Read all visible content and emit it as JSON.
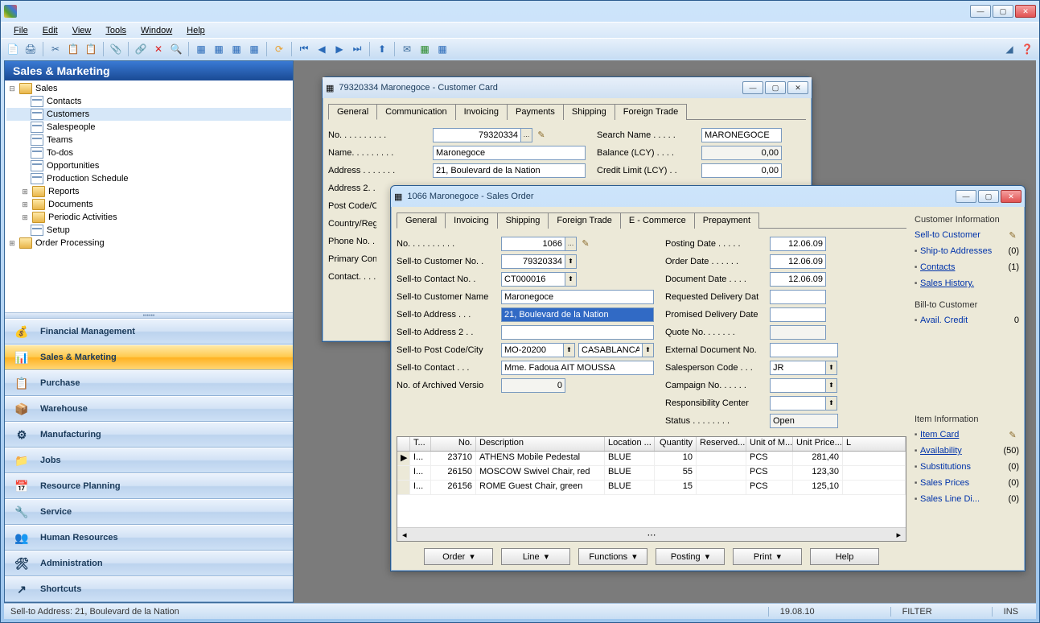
{
  "menubar": [
    "File",
    "Edit",
    "View",
    "Tools",
    "Window",
    "Help"
  ],
  "navigator": {
    "title": "Sales & Marketing",
    "tree": {
      "root": "Sales",
      "items": [
        "Contacts",
        "Customers",
        "Salespeople",
        "Teams",
        "To-dos",
        "Opportunities",
        "Production Schedule",
        "Reports",
        "Documents",
        "Periodic Activities",
        "Setup"
      ],
      "second_root": "Order Processing"
    },
    "buttons": [
      "Financial Management",
      "Sales & Marketing",
      "Purchase",
      "Warehouse",
      "Manufacturing",
      "Jobs",
      "Resource Planning",
      "Service",
      "Human Resources",
      "Administration",
      "Shortcuts"
    ],
    "active_button": 1
  },
  "customer_card": {
    "title": "79320334 Maronegoce - Customer Card",
    "tabs": [
      "General",
      "Communication",
      "Invoicing",
      "Payments",
      "Shipping",
      "Foreign Trade"
    ],
    "fields": {
      "no_label": "No.",
      "no": "79320334",
      "name_label": "Name.",
      "name": "Maronegoce",
      "address_label": "Address",
      "address": "21, Boulevard de la Nation",
      "address2_label": "Address 2.",
      "postcode_label": "Post Code/C",
      "country_label": "Country/Reg",
      "phone_label": "Phone No.",
      "primary_label": "Primary Cont",
      "contact_label": "Contact.",
      "search_label": "Search Name",
      "search": "MARONEGOCE",
      "balance_label": "Balance (LCY)",
      "balance": "0,00",
      "credit_label": "Credit Limit (LCY)",
      "credit": "0,00"
    }
  },
  "sales_order": {
    "title": "1066 Maronegoce - Sales Order",
    "tabs": [
      "General",
      "Invoicing",
      "Shipping",
      "Foreign Trade",
      "E - Commerce",
      "Prepayment"
    ],
    "left": {
      "no_label": "No.",
      "no": "1066",
      "sellcustno_label": "Sell-to Customer No.",
      "sellcustno": "79320334",
      "sellcontno_label": "Sell-to Contact No.",
      "sellcontno": "CT000016",
      "sellcustname_label": "Sell-to Customer Name",
      "sellcustname": "Maronegoce",
      "selladdr_label": "Sell-to Address",
      "selladdr": "21, Boulevard de la Nation",
      "selladdr2_label": "Sell-to Address 2",
      "selladdr2": "",
      "sellpost_label": "Sell-to Post Code/City",
      "sellpost": "MO-20200",
      "sellcity": "CASABLANCA",
      "sellcontact_label": "Sell-to Contact",
      "sellcontact": "Mme. Fadoua AIT MOUSSA",
      "archived_label": "No. of Archived Versions.",
      "archived": "0"
    },
    "right": {
      "posting_label": "Posting Date",
      "posting": "12.06.09",
      "order_label": "Order Date",
      "order": "12.06.09",
      "document_label": "Document Date",
      "document": "12.06.09",
      "reqdeliv_label": "Requested Delivery Date",
      "reqdeliv": "",
      "promdeliv_label": "Promised Delivery Date",
      "promdeliv": "",
      "quote_label": "Quote No.",
      "quote": "",
      "extdoc_label": "External Document No.",
      "extdoc": "",
      "salesperson_label": "Salesperson Code",
      "salesperson": "JR",
      "campaign_label": "Campaign No.",
      "campaign": "",
      "resp_label": "Responsibility Center",
      "resp": "",
      "status_label": "Status",
      "status": "Open"
    },
    "grid": {
      "headers": [
        "T...",
        "No.",
        "Description",
        "Location ...",
        "Quantity",
        "Reserved...",
        "Unit of M...",
        "Unit Price...",
        "L"
      ],
      "rows": [
        {
          "t": "I...",
          "no": "23710",
          "desc": "ATHENS Mobile Pedestal",
          "loc": "BLUE",
          "qty": "10",
          "res": "",
          "uom": "PCS",
          "price": "281,40"
        },
        {
          "t": "I...",
          "no": "26150",
          "desc": "MOSCOW Swivel Chair, red",
          "loc": "BLUE",
          "qty": "55",
          "res": "",
          "uom": "PCS",
          "price": "123,30"
        },
        {
          "t": "I...",
          "no": "26156",
          "desc": "ROME Guest Chair, green",
          "loc": "BLUE",
          "qty": "15",
          "res": "",
          "uom": "PCS",
          "price": "125,10"
        }
      ]
    },
    "buttons": [
      "Order",
      "Line",
      "Functions",
      "Posting",
      "Print",
      "Help"
    ],
    "side": {
      "cust_info": "Customer Information",
      "sellto": "Sell-to Customer",
      "shipto": "Ship-to Addresses",
      "shipto_v": "(0)",
      "contacts": "Contacts",
      "contacts_v": "(1)",
      "saleshist": "Sales History.",
      "billto": "Bill-to Customer",
      "avail": "Avail. Credit",
      "avail_v": "0",
      "item_info": "Item Information",
      "itemcard": "Item Card",
      "availability": "Availability",
      "availability_v": "(50)",
      "subst": "Substitutions",
      "subst_v": "(0)",
      "sprices": "Sales Prices",
      "sprices_v": "(0)",
      "slinedi": "Sales Line Di...",
      "slinedi_v": "(0)"
    }
  },
  "statusbar": {
    "text": "Sell-to Address: 21, Boulevard de la Nation",
    "date": "19.08.10",
    "filter": "FILTER",
    "ins": "INS"
  }
}
